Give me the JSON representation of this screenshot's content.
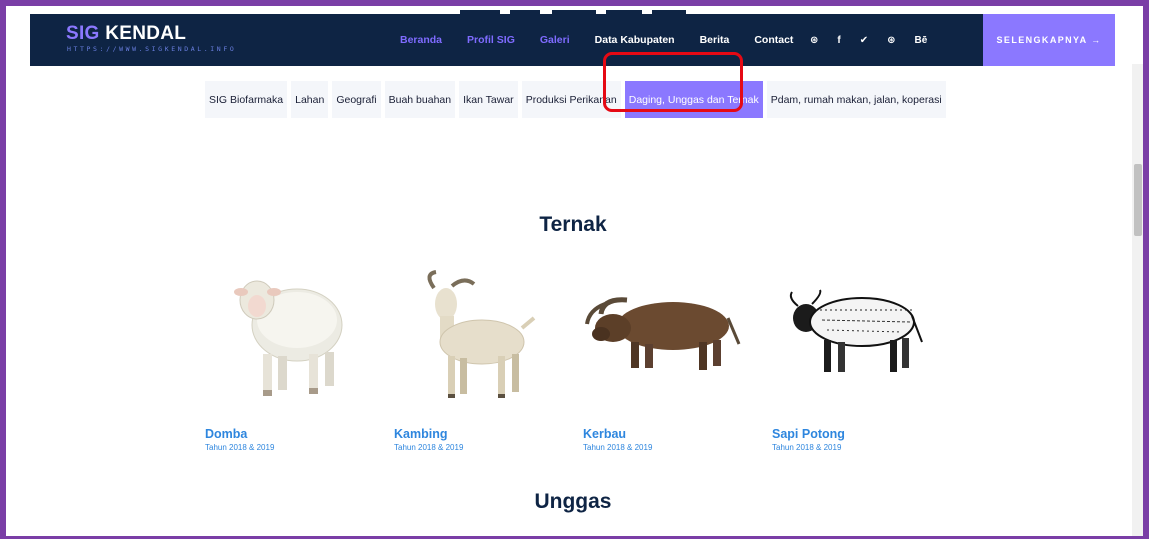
{
  "header": {
    "logo_main": "SIG",
    "logo_accent": "KENDAL",
    "logo_subtitle": "HTTPS://WWW.SIGKENDAL.INFO",
    "nav": [
      {
        "label": "Beranda",
        "active": true
      },
      {
        "label": "Profil SIG",
        "active": true
      },
      {
        "label": "Galeri",
        "active": true
      },
      {
        "label": "Data Kabupaten",
        "active": false
      },
      {
        "label": "Berita",
        "active": false
      },
      {
        "label": "Contact",
        "active": false
      }
    ],
    "social": [
      "⊛",
      "f",
      "✔",
      "⊛",
      "Bē"
    ],
    "cta_label": "SELENGKAPNYA →"
  },
  "tabs": [
    {
      "label": "SIG Biofarmaka",
      "active": false
    },
    {
      "label": "Lahan",
      "active": false
    },
    {
      "label": "Geografi",
      "active": false
    },
    {
      "label": "Buah buahan",
      "active": false
    },
    {
      "label": "Ikan Tawar",
      "active": false
    },
    {
      "label": "Produksi Perikanan",
      "active": false
    },
    {
      "label": "Daging, Unggas dan Ternak",
      "active": true
    },
    {
      "label": "Pdam, rumah makan, jalan, koperasi",
      "active": false
    }
  ],
  "section_ternak": "Ternak",
  "section_unggas": "Unggas",
  "animals": [
    {
      "name": "Domba",
      "year": "Tahun 2018 & 2019",
      "icon": "sheep-image"
    },
    {
      "name": "Kambing",
      "year": "Tahun 2018 & 2019",
      "icon": "goat-image"
    },
    {
      "name": "Kerbau",
      "year": "Tahun 2018 & 2019",
      "icon": "buffalo-image"
    },
    {
      "name": "Sapi Potong",
      "year": "Tahun 2018 & 2019",
      "icon": "cattle-image"
    }
  ],
  "colors": {
    "navy": "#0e2444",
    "accent": "#8b78ff",
    "link": "#2e86de",
    "highlight": "#e50914",
    "frame": "#7a3ea6"
  }
}
